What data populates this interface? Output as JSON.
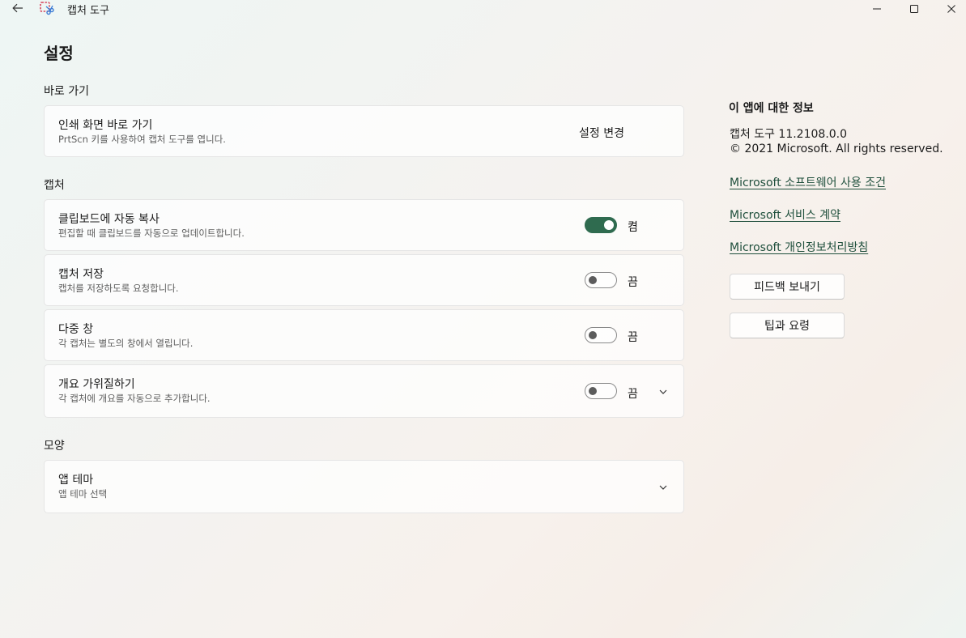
{
  "window": {
    "title": "캡처 도구"
  },
  "page": {
    "title": "설정"
  },
  "sections": {
    "shortcuts": {
      "label": "바로 가기",
      "print_screen": {
        "title": "인쇄 화면 바로 가기",
        "desc": "PrtScn 키를 사용하여 캡처 도구를 엽니다.",
        "action": "설정 변경"
      }
    },
    "capture": {
      "label": "캡처",
      "items": [
        {
          "title": "클립보드에 자동 복사",
          "desc": "편집할 때 클립보드를 자동으로 업데이트합니다.",
          "state": "켬",
          "on": true
        },
        {
          "title": "캡처 저장",
          "desc": "캡처를 저장하도록 요청합니다.",
          "state": "끔",
          "on": false
        },
        {
          "title": "다중 창",
          "desc": "각 캡처는 별도의 창에서 열립니다.",
          "state": "끔",
          "on": false
        },
        {
          "title": "개요 가위질하기",
          "desc": "각 캡처에 개요를 자동으로 추가합니다.",
          "state": "끔",
          "on": false
        }
      ]
    },
    "appearance": {
      "label": "모양",
      "theme": {
        "title": "앱 테마",
        "desc": "앱 테마 선택"
      }
    }
  },
  "about": {
    "heading": "이 앱에 대한 정보",
    "version": "캡처 도구 11.2108.0.0",
    "copyright": "© 2021 Microsoft. All rights reserved.",
    "links": {
      "license": "Microsoft 소프트웨어 사용 조건",
      "service": "Microsoft 서비스 계약",
      "privacy": "Microsoft 개인정보처리방침"
    },
    "buttons": {
      "feedback": "피드백 보내기",
      "tips": "팁과 요령"
    }
  },
  "colors": {
    "accent": "#2f6b4f",
    "link": "#1f4f3c"
  }
}
